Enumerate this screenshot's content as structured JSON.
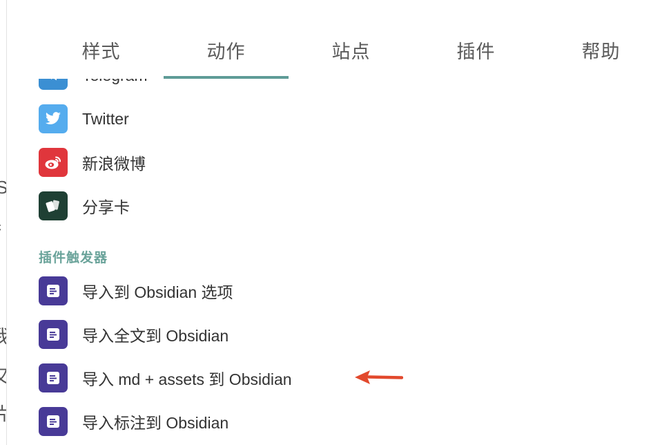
{
  "tabs": [
    {
      "label": "样式",
      "active": false
    },
    {
      "label": "动作",
      "active": true
    },
    {
      "label": "站点",
      "active": false
    },
    {
      "label": "插件",
      "active": false
    },
    {
      "label": "帮助",
      "active": false
    }
  ],
  "background_fragment": {
    "glyphs": [
      "S",
      "扌",
      "我",
      "又",
      "片"
    ]
  },
  "share_items": [
    {
      "label": "Telegram",
      "icon": "telegram-icon",
      "color": "#3b8fd3"
    },
    {
      "label": "Twitter",
      "icon": "twitter-icon",
      "color": "#55acee"
    },
    {
      "label": "新浪微博",
      "icon": "weibo-icon",
      "color": "#e0363c"
    },
    {
      "label": "分享卡",
      "icon": "card-icon",
      "color": "#1f4034"
    }
  ],
  "plugin_section": {
    "title": "插件触发器",
    "items": [
      {
        "label": "导入到 Obsidian 选项",
        "icon": "obsidian-note-icon",
        "color": "#483a97"
      },
      {
        "label": "导入全文到 Obsidian",
        "icon": "obsidian-note-icon",
        "color": "#483a97"
      },
      {
        "label": "导入 md + assets 到 Obsidian",
        "icon": "obsidian-note-icon",
        "color": "#483a97"
      },
      {
        "label": "导入标注到 Obsidian",
        "icon": "obsidian-note-icon",
        "color": "#483a97"
      }
    ]
  },
  "annotation": {
    "icon": "red-arrow-icon",
    "color": "#e2492d"
  }
}
